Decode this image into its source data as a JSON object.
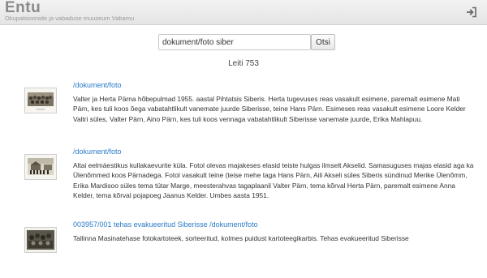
{
  "header": {
    "title": "Entu",
    "subtitle": "Okupatsioonide ja vabaduse muuseum Vabamu",
    "login_icon": "sign-in-icon"
  },
  "search": {
    "value": "dokument/foto siber",
    "button_label": "Otsi"
  },
  "results_count": "Leiti 753",
  "results": [
    {
      "link": "/dokument/foto",
      "description": "Valter ja Herta Pärna hõbepulmad 1955. aastal Pihtatsis Siberis. Herta tugevuses reas vasakult esimene, paremalt esimene Mati Pärn, kes tuli koos õega vabatahtlikult vanemate juurde Siberisse, teine Hans Pärn. Esimeses reas vasakult esimene Loore Kelder Valtri süles, Valter Pärn, Aino Pärn, kes tuli koos vennaga vabatahtlikult Siberisse vanemate juurde, Erika Mahlapuu."
    },
    {
      "link": "/dokument/foto",
      "description": "Altai eelmäestikus kullakaevurite küla. Fotol olevas majakeses elasid teiste hulgas ilmselt Akselid. Samasuguses majas elasid aga ka Ülenõmmed koos Pärnadega. Fotol vasakult teine (teise mehe taga Hans Pärn, Aili Akseli süles Siberis sündinud Merike Ülenõmm, Erika Mardisoo süles tema tütar Marge, meesterahvas tagaplaanil Valter Pärn, tema kõrval Herta Pärn, paremalt esimene Anna Kelder, tema kõrval pojapoeg Jaanus Kelder. Umbes aasta 1951."
    },
    {
      "link": "003957/001 tehas evakueeritud Siberisse /dokument/foto",
      "description": "Tallinna Masinatehase fotokartoteek, sorteeritud, kolmes puidust kartoteegikarbis. Tehas evakueeritud Siberisse"
    }
  ]
}
